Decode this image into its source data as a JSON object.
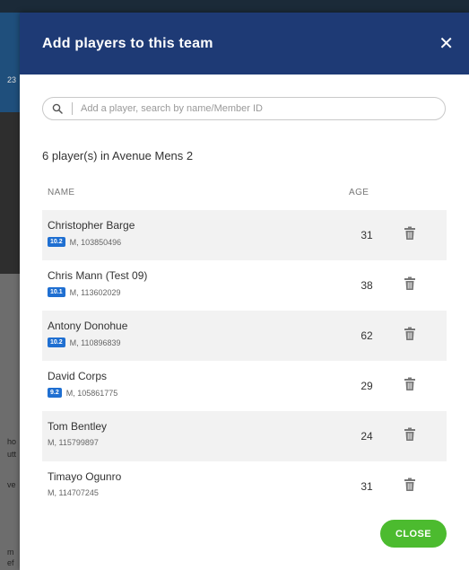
{
  "background": {
    "snippets": [
      "23",
      "ho",
      "utt",
      "ve",
      "m",
      "ef"
    ]
  },
  "modal": {
    "title": "Add players to this team",
    "close_symbol": "✕",
    "search_placeholder": "Add a player, search by name/Member ID",
    "team_count": "6 player(s) in Avenue Mens 2",
    "columns": {
      "name": "NAME",
      "age": "AGE"
    },
    "players": [
      {
        "name": "Christopher Barge",
        "handicap": "10.2",
        "meta": "M, 103850496",
        "age": "31"
      },
      {
        "name": "Chris Mann (Test 09)",
        "handicap": "10.1",
        "meta": "M, 113602029",
        "age": "38"
      },
      {
        "name": "Antony Donohue",
        "handicap": "10.2",
        "meta": "M, 110896839",
        "age": "62"
      },
      {
        "name": "David Corps",
        "handicap": "9.2",
        "meta": "M, 105861775",
        "age": "29"
      },
      {
        "name": "Tom Bentley",
        "handicap": "",
        "meta": "M, 115799897",
        "age": "24"
      },
      {
        "name": "Timayo Ogunro",
        "handicap": "",
        "meta": "M, 114707245",
        "age": "31"
      }
    ],
    "close_button": "CLOSE"
  },
  "icons": {
    "search": "search-icon",
    "trash": "trash-icon",
    "close": "close-icon"
  },
  "colors": {
    "header": "#1e3a75",
    "handicap_badge": "#1f6fd1",
    "close_button": "#4cbb2f"
  }
}
